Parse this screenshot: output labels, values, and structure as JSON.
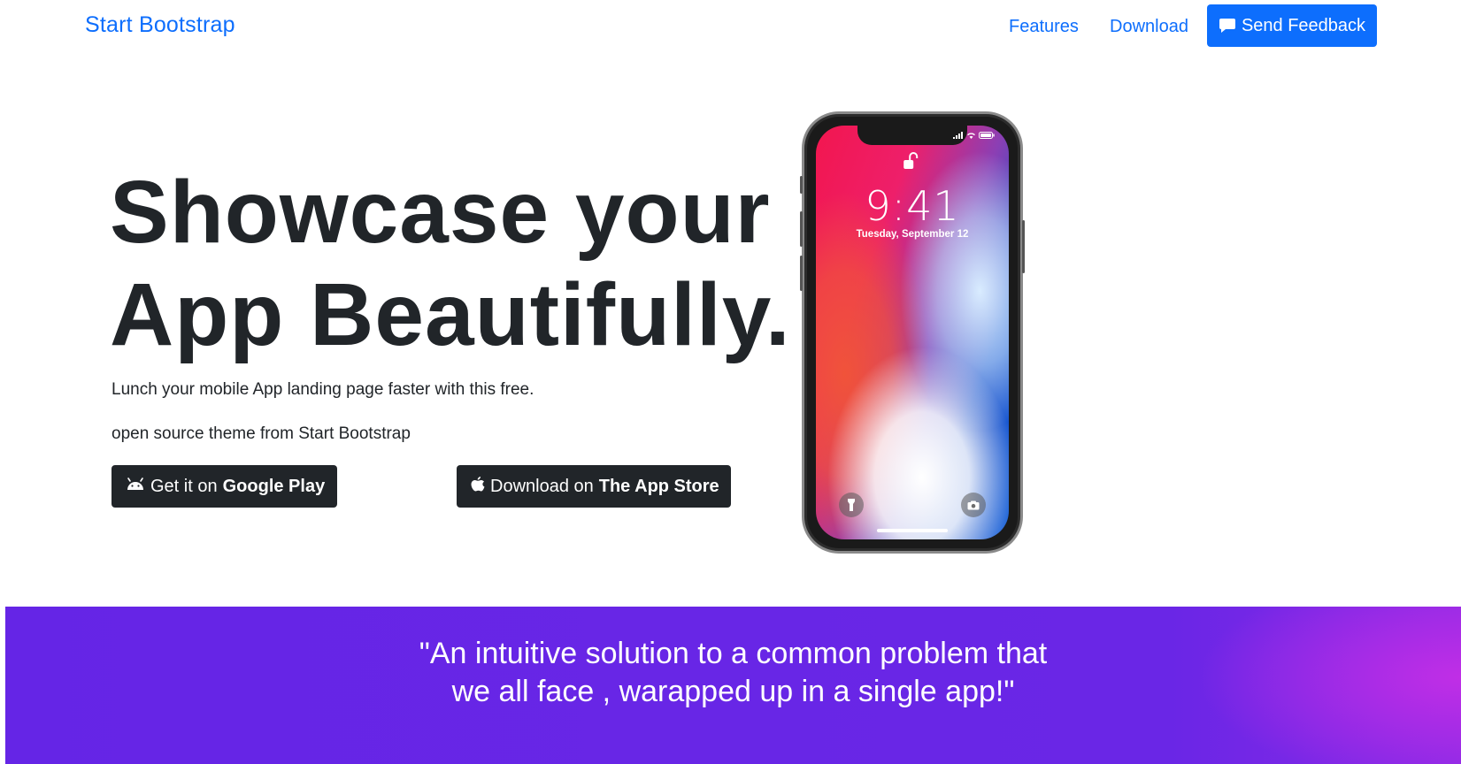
{
  "navbar": {
    "brand": "Start Bootstrap",
    "links": [
      "Features",
      "Download"
    ],
    "feedback_button": "Send Feedback"
  },
  "hero": {
    "title_line_1": "Showcase your",
    "title_line_2": "App Beautifully.",
    "subtitle_line_1": "Lunch your mobile App landing page faster with this free.",
    "subtitle_line_2": "open source theme from Start Bootstrap",
    "google_play": {
      "prefix": "Get it on",
      "store": "Google Play",
      "icon": "android-icon"
    },
    "app_store": {
      "prefix": "Download on",
      "store": "The App Store",
      "icon": "apple-icon"
    }
  },
  "phone": {
    "time": "9:41",
    "date": "Tuesday, September 12"
  },
  "quote": {
    "line_1": "\"An intuitive solution to a common problem that",
    "line_2": "we all face , warapped up in a single app!\""
  },
  "colors": {
    "primary": "#0d6efd",
    "dark_button": "#212529",
    "quote_gradient_start": "#6525e6",
    "quote_gradient_end": "#c02ee6"
  }
}
